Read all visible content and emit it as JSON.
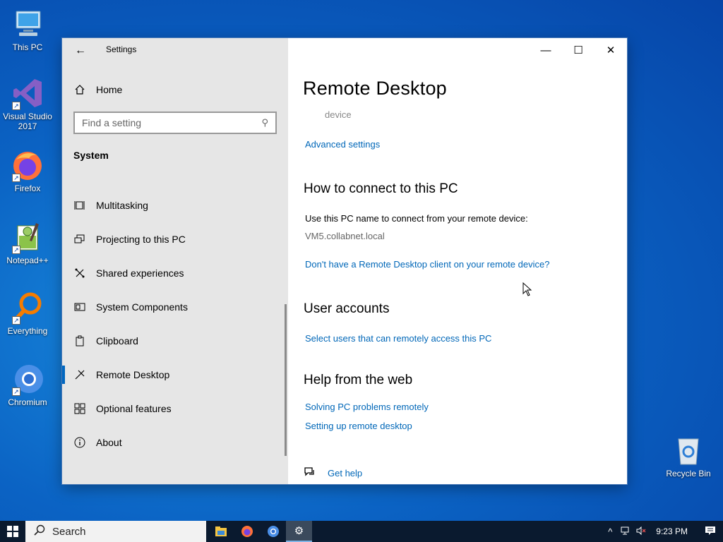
{
  "desktop": {
    "icons": [
      {
        "label": "This PC",
        "icon": "this-pc-icon"
      },
      {
        "label": "Visual Studio 2017",
        "icon": "visual-studio-icon"
      },
      {
        "label": "Firefox",
        "icon": "firefox-icon"
      },
      {
        "label": "Notepad++",
        "icon": "notepad-plus-plus-icon"
      },
      {
        "label": "Everything",
        "icon": "everything-icon"
      },
      {
        "label": "Chromium",
        "icon": "chromium-icon"
      },
      {
        "label": "Recycle Bin",
        "icon": "recycle-bin-icon"
      }
    ]
  },
  "window": {
    "title": "Settings",
    "controls": {
      "minimize": "—",
      "maximize": "☐",
      "close": "✕"
    }
  },
  "sidebar": {
    "home_label": "Home",
    "search_placeholder": "Find a setting",
    "section": "System",
    "items": [
      {
        "label": "Multitasking",
        "icon": "multitasking-icon"
      },
      {
        "label": "Projecting to this PC",
        "icon": "projecting-icon"
      },
      {
        "label": "Shared experiences",
        "icon": "shared-experiences-icon"
      },
      {
        "label": "System Components",
        "icon": "system-components-icon"
      },
      {
        "label": "Clipboard",
        "icon": "clipboard-icon"
      },
      {
        "label": "Remote Desktop",
        "icon": "remote-desktop-icon",
        "selected": true
      },
      {
        "label": "Optional features",
        "icon": "optional-features-icon"
      },
      {
        "label": "About",
        "icon": "about-icon"
      }
    ]
  },
  "main": {
    "page_title": "Remote Desktop",
    "faded_text": "device",
    "advanced_settings": "Advanced settings",
    "connect_heading": "How to connect to this PC",
    "connect_instruction": "Use this PC name to connect from your remote device:",
    "pc_name": "VM5.collabnet.local",
    "client_link": "Don't have a Remote Desktop client on your remote device?",
    "user_accounts_heading": "User accounts",
    "select_users_link": "Select users that can remotely access this PC",
    "help_heading": "Help from the web",
    "help_links": [
      "Solving PC problems remotely",
      "Setting up remote desktop"
    ],
    "get_help": "Get help"
  },
  "taskbar": {
    "search_label": "Search",
    "clock": "9:23 PM",
    "apps": [
      "file-explorer-icon",
      "firefox-icon",
      "chromium-icon",
      "settings-icon"
    ]
  },
  "colors": {
    "accent": "#0067b8",
    "sidebar_bg": "#e6e6e6",
    "taskbar_bg": "#0a1a2f"
  }
}
